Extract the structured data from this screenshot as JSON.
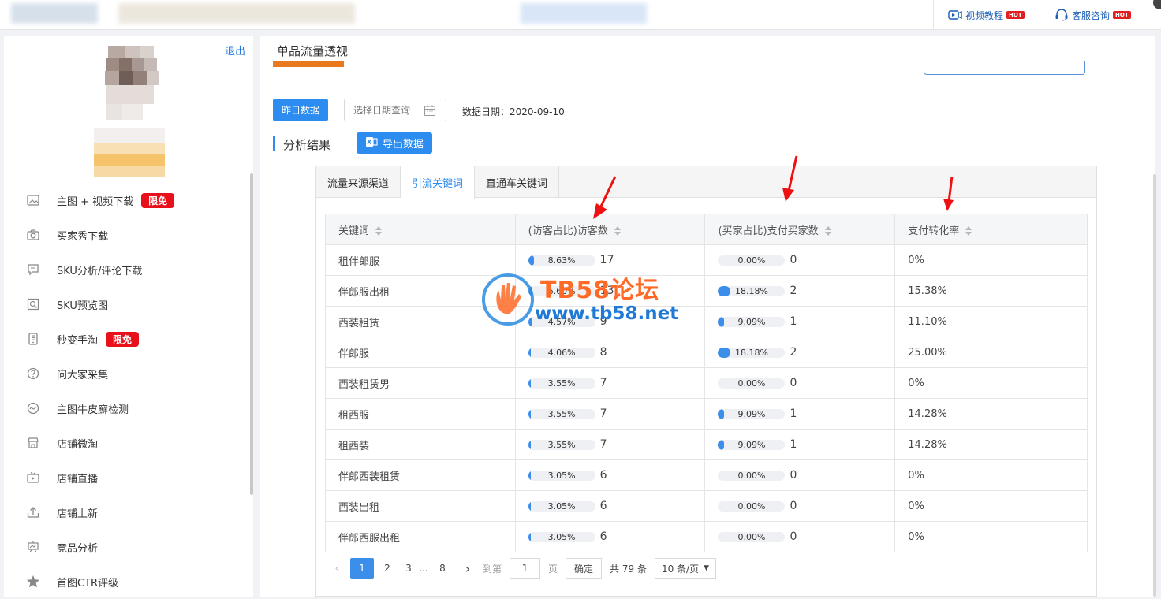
{
  "topbar": {
    "video_tutorial": "视频教程",
    "customer_service": "客服咨询",
    "hot": "HOT"
  },
  "sidebar": {
    "logout": "退出",
    "items": [
      {
        "label": "主图 + 视频下载",
        "icon": "image-icon",
        "badge": "限免"
      },
      {
        "label": "买家秀下载",
        "icon": "camera-icon",
        "badge": ""
      },
      {
        "label": "SKU分析/评论下载",
        "icon": "comment-icon",
        "badge": ""
      },
      {
        "label": "SKU预览图",
        "icon": "preview-icon",
        "badge": ""
      },
      {
        "label": "秒变手淘",
        "icon": "phone-icon",
        "badge": "限免"
      },
      {
        "label": "问大家采集",
        "icon": "question-icon",
        "badge": ""
      },
      {
        "label": "主图牛皮廯检测",
        "icon": "wave-icon",
        "badge": ""
      },
      {
        "label": "店铺微淘",
        "icon": "store-icon",
        "badge": ""
      },
      {
        "label": "店铺直播",
        "icon": "tv-icon",
        "badge": ""
      },
      {
        "label": "店铺上新",
        "icon": "upload-icon",
        "badge": ""
      },
      {
        "label": "竞品分析",
        "icon": "easel-icon",
        "badge": ""
      },
      {
        "label": "首图CTR评级",
        "icon": "star-icon",
        "badge": ""
      }
    ]
  },
  "main": {
    "page_title": "单品流量透视",
    "yesterday_button": "昨日数据",
    "date_placeholder": "选择日期查询",
    "data_date": "数据日期：2020-09-10",
    "section_title": "分析结果",
    "export_button": "导出数据",
    "tabs": [
      "流量来源渠道",
      "引流关键词",
      "直通车关键词"
    ],
    "active_tab": 1,
    "columns": [
      "关键词",
      "(访客占比)访客数",
      "(买家占比)支付买家数",
      "支付转化率"
    ],
    "rows": [
      {
        "keyword": "租伴郎服",
        "visitor_pct": "8.63%",
        "visitor_ratio": 0.0863,
        "visitors": "17",
        "buyer_pct": "0.00%",
        "buyer_ratio": 0,
        "buyers": "0",
        "conversion": "0%"
      },
      {
        "keyword": "伴郎服出租",
        "visitor_pct": "6.60%",
        "visitor_ratio": 0.066,
        "visitors": "13",
        "buyer_pct": "18.18%",
        "buyer_ratio": 0.1818,
        "buyers": "2",
        "conversion": "15.38%"
      },
      {
        "keyword": "西装租赁",
        "visitor_pct": "4.57%",
        "visitor_ratio": 0.0457,
        "visitors": "9",
        "buyer_pct": "9.09%",
        "buyer_ratio": 0.0909,
        "buyers": "1",
        "conversion": "11.10%"
      },
      {
        "keyword": "伴郎服",
        "visitor_pct": "4.06%",
        "visitor_ratio": 0.0406,
        "visitors": "8",
        "buyer_pct": "18.18%",
        "buyer_ratio": 0.1818,
        "buyers": "2",
        "conversion": "25.00%"
      },
      {
        "keyword": "西装租赁男",
        "visitor_pct": "3.55%",
        "visitor_ratio": 0.0355,
        "visitors": "7",
        "buyer_pct": "0.00%",
        "buyer_ratio": 0,
        "buyers": "0",
        "conversion": "0%"
      },
      {
        "keyword": "租西服",
        "visitor_pct": "3.55%",
        "visitor_ratio": 0.0355,
        "visitors": "7",
        "buyer_pct": "9.09%",
        "buyer_ratio": 0.0909,
        "buyers": "1",
        "conversion": "14.28%"
      },
      {
        "keyword": "租西装",
        "visitor_pct": "3.55%",
        "visitor_ratio": 0.0355,
        "visitors": "7",
        "buyer_pct": "9.09%",
        "buyer_ratio": 0.0909,
        "buyers": "1",
        "conversion": "14.28%"
      },
      {
        "keyword": "伴郎西装租赁",
        "visitor_pct": "3.05%",
        "visitor_ratio": 0.0305,
        "visitors": "6",
        "buyer_pct": "0.00%",
        "buyer_ratio": 0,
        "buyers": "0",
        "conversion": "0%"
      },
      {
        "keyword": "西装出租",
        "visitor_pct": "3.05%",
        "visitor_ratio": 0.0305,
        "visitors": "6",
        "buyer_pct": "0.00%",
        "buyer_ratio": 0,
        "buyers": "0",
        "conversion": "0%"
      },
      {
        "keyword": "伴郎西服出租",
        "visitor_pct": "3.05%",
        "visitor_ratio": 0.0305,
        "visitors": "6",
        "buyer_pct": "0.00%",
        "buyer_ratio": 0,
        "buyers": "0",
        "conversion": "0%"
      }
    ],
    "pagination": {
      "pages": [
        "1",
        "2",
        "3",
        "...",
        "8"
      ],
      "current": "1",
      "goto_label": "到第",
      "goto_value": "1",
      "page_unit": "页",
      "confirm": "确定",
      "total": "共 79 条",
      "page_size": "10 条/页"
    }
  },
  "watermark": {
    "title": "TB58论坛",
    "url": "www.tb58.net"
  },
  "colors": {
    "primary": "#2d8cf0",
    "badge_red": "#e8101a",
    "bar_fill": "#3b8eea",
    "watermark_orange": "#ff6a26"
  }
}
